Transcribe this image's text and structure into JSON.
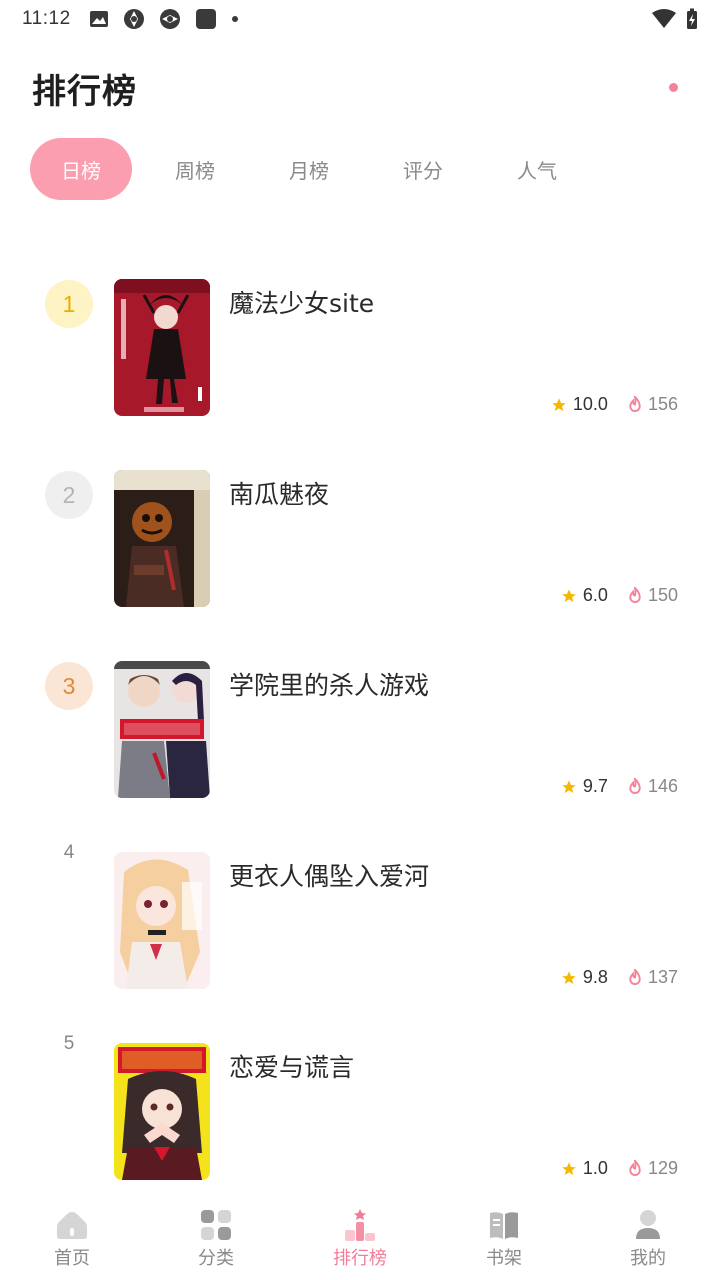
{
  "status_bar": {
    "time": "11:12"
  },
  "header": {
    "title": "排行榜"
  },
  "tabs": [
    {
      "label": "日榜",
      "active": true
    },
    {
      "label": "周榜",
      "active": false
    },
    {
      "label": "月榜",
      "active": false
    },
    {
      "label": "评分",
      "active": false
    },
    {
      "label": "人气",
      "active": false
    }
  ],
  "ranking": [
    {
      "rank": "1",
      "title": "魔法少女site",
      "score": "10.0",
      "hot": "156"
    },
    {
      "rank": "2",
      "title": "南瓜魅夜",
      "score": "6.0",
      "hot": "150"
    },
    {
      "rank": "3",
      "title": "学院里的杀人游戏",
      "score": "9.7",
      "hot": "146"
    },
    {
      "rank": "4",
      "title": "更衣人偶坠入爱河",
      "score": "9.8",
      "hot": "137"
    },
    {
      "rank": "5",
      "title": "恋爱与谎言",
      "score": "1.0",
      "hot": "129"
    }
  ],
  "bottom_nav": [
    {
      "label": "首页",
      "icon": "home-icon"
    },
    {
      "label": "分类",
      "icon": "grid-icon"
    },
    {
      "label": "排行榜",
      "icon": "podium-icon",
      "active": true
    },
    {
      "label": "书架",
      "icon": "book-icon"
    },
    {
      "label": "我的",
      "icon": "user-icon"
    }
  ],
  "colors": {
    "accent": "#fb9fb0",
    "accent_text": "#f17e96",
    "star": "#f5b800",
    "flame": "#f4829a"
  }
}
